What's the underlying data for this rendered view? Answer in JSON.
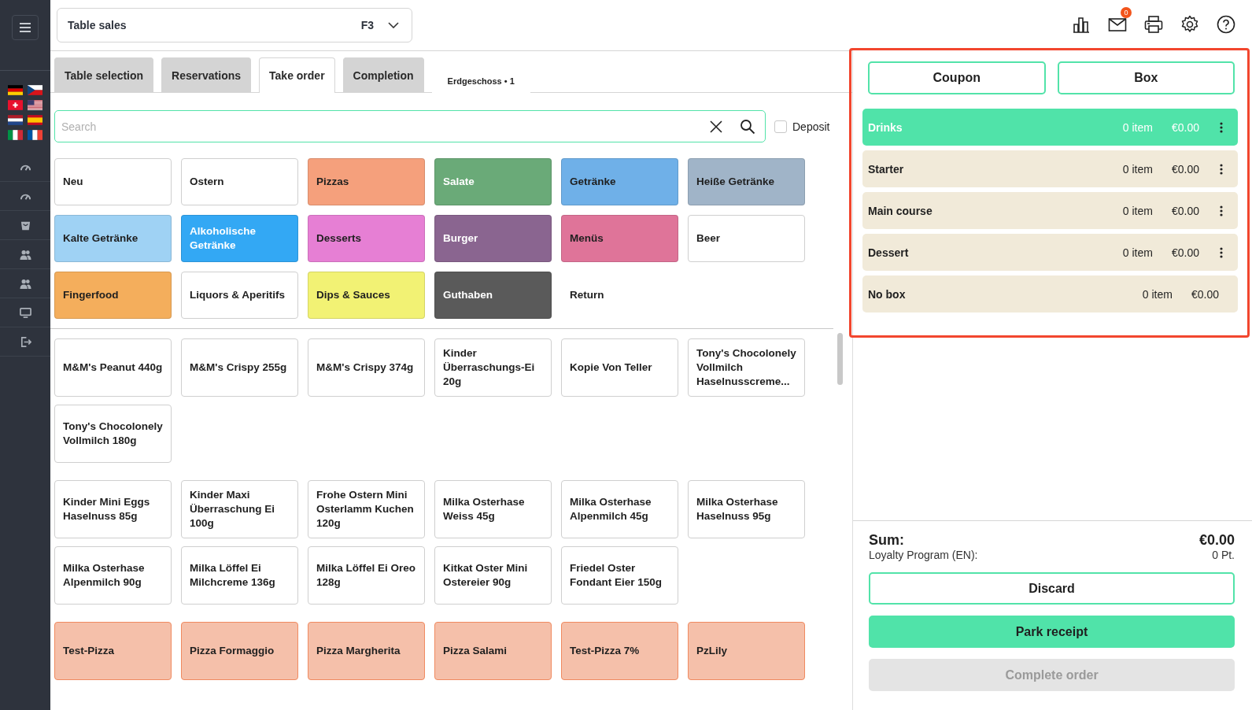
{
  "header": {
    "mode": "Table sales",
    "shortcut": "F3",
    "mail_badge": "0"
  },
  "tabs": [
    {
      "label": "Table selection",
      "selected": false
    },
    {
      "label": "Reservations",
      "selected": false
    },
    {
      "label": "Take order",
      "selected": true
    },
    {
      "label": "Completion",
      "selected": false
    }
  ],
  "floor_tab": {
    "label": "Erdgeschoss • 1"
  },
  "search": {
    "placeholder": "Search"
  },
  "deposit": {
    "label": "Deposit",
    "checked": false
  },
  "categories": [
    {
      "kind": "category",
      "label": "Neu",
      "color": "#ffffff"
    },
    {
      "kind": "category",
      "label": "Ostern",
      "color": "#ffffff"
    },
    {
      "kind": "category",
      "label": "Pizzas",
      "color": "#f5a07c"
    },
    {
      "kind": "category",
      "label": "Salate",
      "color": "#6aaa78"
    },
    {
      "kind": "category",
      "label": "Getränke",
      "color": "#6fb0e8"
    },
    {
      "kind": "category",
      "label": "Heiße Getränke",
      "color": "#a0b4c8"
    },
    {
      "kind": "category",
      "label": "Kalte Getränke",
      "color": "#9fd2f4"
    },
    {
      "kind": "category",
      "label": "Alkoholische Getränke",
      "color": "#33a8f4"
    },
    {
      "kind": "category",
      "label": "Desserts",
      "color": "#e67fd4"
    },
    {
      "kind": "category",
      "label": "Burger",
      "color": "#8a6590"
    },
    {
      "kind": "category",
      "label": "Menüs",
      "color": "#df7499"
    },
    {
      "kind": "category",
      "label": "Beer",
      "color": "#ffffff"
    },
    {
      "kind": "category",
      "label": "Fingerfood",
      "color": "#f4ae5c"
    },
    {
      "kind": "category",
      "label": "Liquors & Aperitifs",
      "color": "#ffffff"
    },
    {
      "kind": "category",
      "label": "Dips & Sauces",
      "color": "#f2f274"
    },
    {
      "kind": "category",
      "label": "Guthaben",
      "color": "#5a5a5a"
    },
    {
      "kind": "action",
      "label": "Return"
    }
  ],
  "product_groups": [
    {
      "color": "#ffffff",
      "items": [
        "M&M's Peanut 440g",
        "M&M's Crispy 255g",
        "M&M's Crispy 374g",
        "Kinder Überraschungs-Ei 20g",
        "Kopie Von Teller",
        "Tony's Chocolonely Vollmilch Haselnusscreme...",
        "Tony's Chocolonely Vollmilch 180g"
      ]
    },
    {
      "color": "#ffffff",
      "items": [
        "Kinder Mini Eggs Haselnuss 85g",
        "Kinder Maxi Überraschung Ei 100g",
        "Frohe Ostern Mini Osterlamm Kuchen 120g",
        "Milka Osterhase Weiss 45g",
        "Milka Osterhase Alpenmilch 45g",
        "Milka Osterhase Haselnuss 95g",
        "Milka Osterhase Alpenmilch 90g",
        "Milka Löffel Ei Milchcreme 136g",
        "Milka Löffel Ei Oreo 128g",
        "Kitkat Oster Mini Ostereier 90g",
        "Friedel Oster Fondant Eier 150g"
      ]
    },
    {
      "color": "#f5c0aa",
      "items": [
        "Test-Pizza",
        "Pizza Formaggio",
        "Pizza Margherita",
        "Pizza Salami",
        "Test-Pizza 7%",
        "PzLily"
      ]
    }
  ],
  "order_buttons": [
    "Coupon",
    "Box"
  ],
  "boxes": [
    {
      "name": "Drinks",
      "count": "0 item",
      "amount": "€0.00",
      "selected": true,
      "menu": true
    },
    {
      "name": "Starter",
      "count": "0 item",
      "amount": "€0.00",
      "selected": false,
      "menu": true
    },
    {
      "name": "Main course",
      "count": "0 item",
      "amount": "€0.00",
      "selected": false,
      "menu": true
    },
    {
      "name": "Dessert",
      "count": "0 item",
      "amount": "€0.00",
      "selected": false,
      "menu": true
    },
    {
      "name": "No box",
      "count": "0 item",
      "amount": "€0.00",
      "selected": false,
      "menu": false
    }
  ],
  "summary": {
    "sum_label": "Sum:",
    "sum_value": "€0.00",
    "loyalty_label": "Loyalty Program (EN):",
    "loyalty_value": "0 Pt."
  },
  "actions": [
    {
      "label": "Discard",
      "kind": "outline",
      "disabled": false
    },
    {
      "label": "Park receipt",
      "kind": "primary",
      "disabled": false
    },
    {
      "label": "Complete order",
      "kind": "primary",
      "disabled": true
    }
  ]
}
